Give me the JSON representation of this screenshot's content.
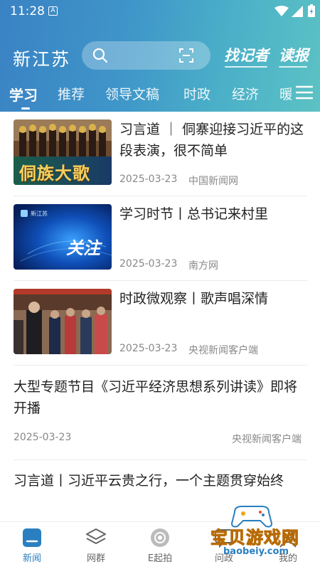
{
  "status": {
    "time": "11:28",
    "notif_glyph": "A"
  },
  "header": {
    "brand": "新江苏",
    "find_reporter": "找记者",
    "read_paper": "读报"
  },
  "tabs": [
    {
      "label": "学习",
      "active": true
    },
    {
      "label": "推荐"
    },
    {
      "label": "领导文稿"
    },
    {
      "label": "时政"
    },
    {
      "label": "经济"
    },
    {
      "label": "暖"
    }
  ],
  "news": [
    {
      "title": "习言道 ｜ 侗寨迎接习近平的这段表演，很不简单",
      "date": "2025-03-23",
      "source": "中国新闻网",
      "image_caption": "侗族大歌"
    },
    {
      "title": "学习时节丨总书记来村里",
      "date": "2025-03-23",
      "source": "南方网",
      "image_caption": "关注",
      "image_brand": "新江苏"
    },
    {
      "title": "时政微观察丨歌声唱深情",
      "date": "2025-03-23",
      "source": "央视新闻客户端"
    },
    {
      "title": "大型专题节目《习近平经济思想系列讲读》即将开播",
      "date": "2025-03-23",
      "source": "央视新闻客户端"
    },
    {
      "title": "习言道丨习近平云贵之行，一个主题贯穿始终"
    }
  ],
  "bottom_nav": [
    {
      "label": "新闻",
      "icon": "news-icon",
      "active": true
    },
    {
      "label": "网群",
      "icon": "layers-icon"
    },
    {
      "label": "E起拍",
      "icon": "camera-icon"
    },
    {
      "label": "问政",
      "icon": "chat-icon"
    },
    {
      "label": "我的",
      "icon": "user-icon"
    }
  ],
  "watermark": {
    "text": "宝贝游戏网",
    "url": "baobeiy.com"
  },
  "colors": {
    "accent": "#2a7fc0",
    "header_start": "#3a82c4",
    "header_end": "#5cc2c4"
  }
}
